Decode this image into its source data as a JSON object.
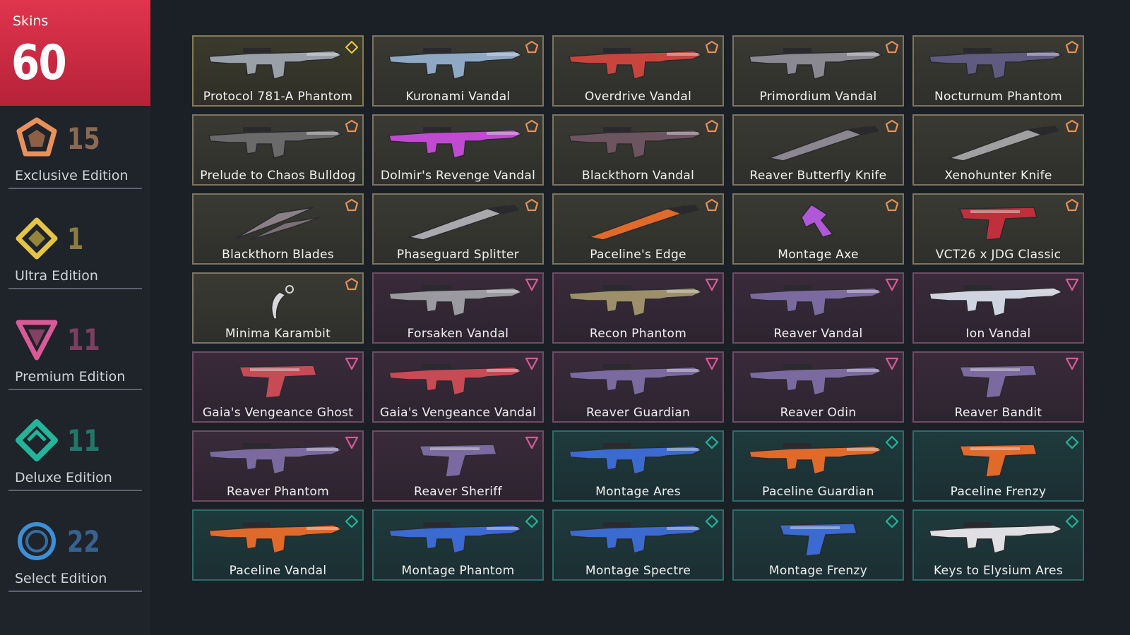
{
  "summary": {
    "label": "Skins",
    "count": "60"
  },
  "tiers": [
    {
      "key": "exclusive",
      "count": "15",
      "name": "Exclusive Edition",
      "color": "#e8915a",
      "count_color": "#8a6a52"
    },
    {
      "key": "ultra",
      "count": "1",
      "name": "Ultra Edition",
      "color": "#e5c546",
      "count_color": "#8c7c44"
    },
    {
      "key": "premium",
      "count": "11",
      "name": "Premium Edition",
      "color": "#d85a97",
      "count_color": "#7c3f60"
    },
    {
      "key": "deluxe",
      "count": "11",
      "name": "Deluxe Edition",
      "color": "#23b59a",
      "count_color": "#23766a"
    },
    {
      "key": "select",
      "count": "22",
      "name": "Select Edition",
      "color": "#3d8fd6",
      "count_color": "#36628d"
    }
  ],
  "skins": [
    {
      "name": "Protocol 781-A Phantom",
      "tier": "ultra",
      "icon": "rifle-icon",
      "accent": "#9aa0a8"
    },
    {
      "name": "Kuronami Vandal",
      "tier": "exclusive",
      "icon": "rifle-icon",
      "accent": "#8fa8c4"
    },
    {
      "name": "Overdrive Vandal",
      "tier": "exclusive",
      "icon": "rifle-icon",
      "accent": "#c8453d"
    },
    {
      "name": "Primordium Vandal",
      "tier": "exclusive",
      "icon": "rifle-icon",
      "accent": "#8a8890"
    },
    {
      "name": "Nocturnum Phantom",
      "tier": "exclusive",
      "icon": "rifle-icon",
      "accent": "#5f5a80"
    },
    {
      "name": "Prelude to Chaos Bulldog",
      "tier": "exclusive",
      "icon": "rifle-icon",
      "accent": "#6a6a6a"
    },
    {
      "name": "Dolmir's Revenge Vandal",
      "tier": "exclusive",
      "icon": "rifle-icon",
      "accent": "#c04bd0"
    },
    {
      "name": "Blackthorn Vandal",
      "tier": "exclusive",
      "icon": "rifle-icon",
      "accent": "#6d5560"
    },
    {
      "name": "Reaver Butterfly Knife",
      "tier": "exclusive",
      "icon": "knife-icon",
      "accent": "#8b8690"
    },
    {
      "name": "Xenohunter Knife",
      "tier": "exclusive",
      "icon": "knife-icon",
      "accent": "#a0a0a0"
    },
    {
      "name": "Blackthorn Blades",
      "tier": "exclusive",
      "icon": "blades-icon",
      "accent": "#8c8088"
    },
    {
      "name": "Phaseguard Splitter",
      "tier": "exclusive",
      "icon": "knife-icon",
      "accent": "#a9a9ad"
    },
    {
      "name": "Paceline's Edge",
      "tier": "exclusive",
      "icon": "knife-icon",
      "accent": "#e06a2a"
    },
    {
      "name": "Montage Axe",
      "tier": "exclusive",
      "icon": "axe-icon",
      "accent": "#b058d8"
    },
    {
      "name": "VCT26 x JDG Classic",
      "tier": "exclusive",
      "icon": "pistol-icon",
      "accent": "#c0303a"
    },
    {
      "name": "Minima Karambit",
      "tier": "exclusive",
      "icon": "karambit-icon",
      "accent": "#d8d8d8"
    },
    {
      "name": "Forsaken Vandal",
      "tier": "premium",
      "icon": "rifle-icon",
      "accent": "#9a9aa0"
    },
    {
      "name": "Recon Phantom",
      "tier": "premium",
      "icon": "rifle-icon",
      "accent": "#9c8f6a"
    },
    {
      "name": "Reaver Vandal",
      "tier": "premium",
      "icon": "rifle-icon",
      "accent": "#7a6aa0"
    },
    {
      "name": "Ion Vandal",
      "tier": "premium",
      "icon": "rifle-icon",
      "accent": "#d0d4e0"
    },
    {
      "name": "Gaia's Vengeance Ghost",
      "tier": "premium",
      "icon": "pistol-icon",
      "accent": "#c84a55"
    },
    {
      "name": "Gaia's Vengeance Vandal",
      "tier": "premium",
      "icon": "rifle-icon",
      "accent": "#c84a55"
    },
    {
      "name": "Reaver Guardian",
      "tier": "premium",
      "icon": "rifle-icon",
      "accent": "#7a6aa0"
    },
    {
      "name": "Reaver Odin",
      "tier": "premium",
      "icon": "rifle-icon",
      "accent": "#7a6aa0"
    },
    {
      "name": "Reaver Bandit",
      "tier": "premium",
      "icon": "pistol-icon",
      "accent": "#7a6aa0"
    },
    {
      "name": "Reaver Phantom",
      "tier": "premium",
      "icon": "rifle-icon",
      "accent": "#7a6aa0"
    },
    {
      "name": "Reaver Sheriff",
      "tier": "premium",
      "icon": "pistol-icon",
      "accent": "#7a6aa0"
    },
    {
      "name": "Montage Ares",
      "tier": "deluxe",
      "icon": "rifle-icon",
      "accent": "#3b6ad0"
    },
    {
      "name": "Paceline Guardian",
      "tier": "deluxe",
      "icon": "rifle-icon",
      "accent": "#e06a2a"
    },
    {
      "name": "Paceline Frenzy",
      "tier": "deluxe",
      "icon": "pistol-icon",
      "accent": "#e06a2a"
    },
    {
      "name": "Paceline Vandal",
      "tier": "deluxe",
      "icon": "rifle-icon",
      "accent": "#e06a2a"
    },
    {
      "name": "Montage Phantom",
      "tier": "deluxe",
      "icon": "rifle-icon",
      "accent": "#3b6ad0"
    },
    {
      "name": "Montage Spectre",
      "tier": "deluxe",
      "icon": "rifle-icon",
      "accent": "#3b6ad0"
    },
    {
      "name": "Montage Frenzy",
      "tier": "deluxe",
      "icon": "pistol-icon",
      "accent": "#3b6ad0"
    },
    {
      "name": "Keys to Elysium Ares",
      "tier": "deluxe",
      "icon": "rifle-icon",
      "accent": "#e0e0e4"
    }
  ]
}
